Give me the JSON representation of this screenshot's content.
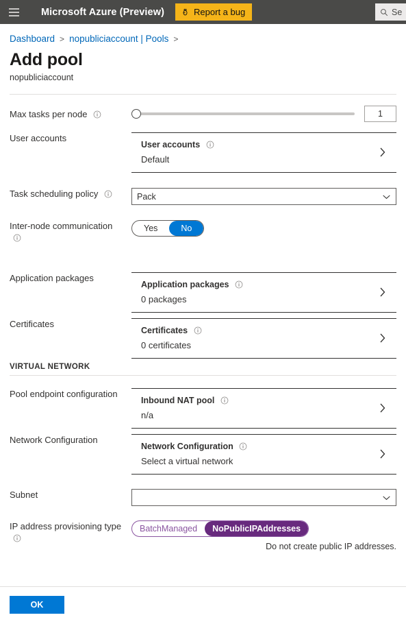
{
  "topbar": {
    "menu_icon": "hamburger-icon",
    "brand": "Microsoft Azure (Preview)",
    "report_bug_label": "Report a bug",
    "report_bug_icon": "bug-icon",
    "report_bug_color": "#f5b419",
    "search_icon": "search-icon",
    "search_placeholder": "Se",
    "background": "#4a4a48"
  },
  "breadcrumb": {
    "items": [
      "Dashboard",
      "nopubliciaccount | Pools"
    ],
    "separator": ">",
    "link_color": "#0067b8"
  },
  "page": {
    "title": "Add pool",
    "subtitle": "nopubliciaccount"
  },
  "form": {
    "max_tasks": {
      "label": "Max tasks per node",
      "info_icon": "info-icon",
      "value": "1",
      "slider_position_pct": 0
    },
    "user_accounts": {
      "label": "User accounts",
      "card_title": "User accounts",
      "card_value": "Default",
      "info_icon": "info-icon",
      "chevron_icon": "chevron-right-icon"
    },
    "task_scheduling_policy": {
      "label": "Task scheduling policy",
      "info_icon": "info-icon",
      "value": "Pack",
      "chevron_icon": "chevron-down-icon"
    },
    "inter_node_communication": {
      "label": "Inter-node communication",
      "info_icon": "info-icon",
      "options": [
        "Yes",
        "No"
      ],
      "selected": "No",
      "accent_color": "#0078d4"
    },
    "application_packages": {
      "label": "Application packages",
      "card_title": "Application packages",
      "card_value": "0 packages",
      "info_icon": "info-icon",
      "chevron_icon": "chevron-right-icon"
    },
    "certificates": {
      "label": "Certificates",
      "card_title": "Certificates",
      "card_value": "0 certificates",
      "info_icon": "info-icon",
      "chevron_icon": "chevron-right-icon"
    },
    "virtual_network_section": "VIRTUAL NETWORK",
    "pool_endpoint_configuration": {
      "label": "Pool endpoint configuration",
      "card_title": "Inbound NAT pool",
      "card_value": "n/a",
      "info_icon": "info-icon",
      "chevron_icon": "chevron-right-icon"
    },
    "network_configuration": {
      "label": "Network Configuration",
      "card_title": "Network Configuration",
      "card_value": "Select a virtual network",
      "info_icon": "info-icon",
      "chevron_icon": "chevron-right-icon"
    },
    "subnet": {
      "label": "Subnet",
      "value": "",
      "chevron_icon": "chevron-down-icon"
    },
    "ip_address_provisioning_type": {
      "label": "IP address provisioning type",
      "info_icon": "info-icon",
      "options": [
        "BatchManaged",
        "NoPublicIPAddresses"
      ],
      "selected": "NoPublicIPAddresses",
      "helper_text": "Do not create public IP addresses.",
      "accent_color": "#682a7e",
      "inactive_color": "#8a55a0"
    }
  },
  "footer": {
    "ok_label": "OK",
    "ok_color": "#0078d4"
  }
}
